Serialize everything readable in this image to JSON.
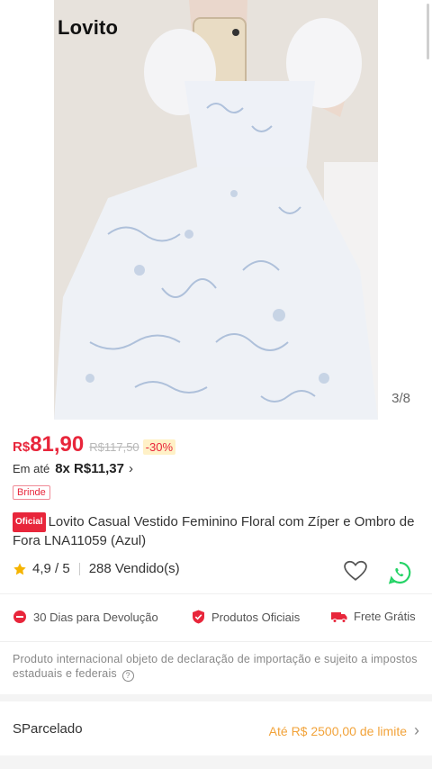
{
  "gallery": {
    "brand": "Lovito",
    "counter": "3/8"
  },
  "price": {
    "currency": "R$",
    "current": "81,90",
    "original": "R$117,50",
    "discount": "-30%",
    "installments_prefix": "Em até",
    "installments": "8x R$11,37",
    "gift_label": "Brinde"
  },
  "product": {
    "official_badge": "Oficial",
    "title": "Lovito Casual Vestido Feminino Floral com Zíper e Ombro de Fora LNA11059 (Azul)",
    "rating": "4,9 / 5",
    "sold": "288 Vendido(s)"
  },
  "guarantees": [
    {
      "label": "30 Dias para Devolução",
      "icon": "return-icon"
    },
    {
      "label": "Produtos Oficiais",
      "icon": "shield-check-icon"
    },
    {
      "label": "Frete Grátis",
      "icon": "truck-icon"
    }
  ],
  "notice": "Produto internacional objeto de declaração de importação e sujeito a impostos estaduais e federais",
  "sparcelado": {
    "label": "SParcelado",
    "limit": "Até R$ 2500,00 de limite"
  },
  "colors": {
    "accent": "#e8263b",
    "limit_orange": "#f2a33a",
    "whatsapp": "#25d366"
  }
}
